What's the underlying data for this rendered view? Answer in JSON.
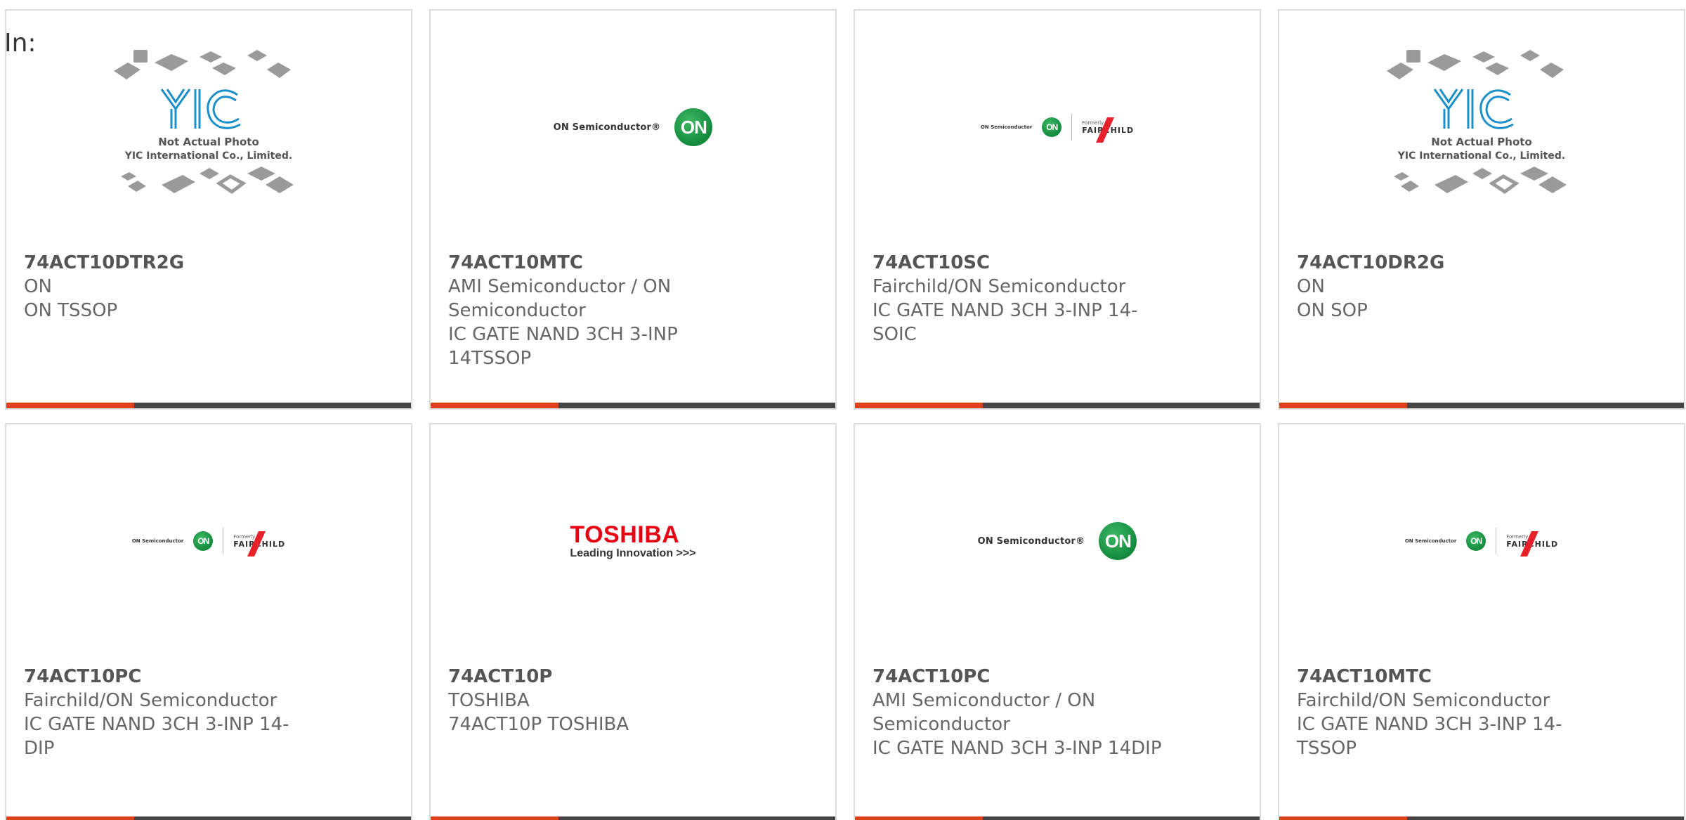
{
  "page": {
    "in_label": "In:"
  },
  "products": [
    {
      "part_no": "74ACT10DTR2G",
      "manufacturer": "ON",
      "description": "ON TSSOP",
      "image": "yic-not-actual-photo",
      "image_caption_1": "Not Actual Photo",
      "image_caption_2": "YIC International Co., Limited."
    },
    {
      "part_no": "74ACT10MTC",
      "manufacturer": "AMI Semiconductor / ON Semiconductor",
      "description": "IC GATE NAND 3CH 3-INP 14TSSOP",
      "image": "on-semiconductor-logo",
      "logo_text": "ON Semiconductor®",
      "logo_mark": "ON"
    },
    {
      "part_no": "74ACT10SC",
      "manufacturer": "Fairchild/ON Semiconductor",
      "description": "IC GATE NAND 3CH 3-INP 14-SOIC",
      "image": "on-fairchild-logo",
      "logo_text": "ON Semiconductor",
      "logo_mark": "ON",
      "formerly": "Formerly",
      "fairchild": "FAIRCHILD"
    },
    {
      "part_no": "74ACT10DR2G",
      "manufacturer": "ON",
      "description": "ON SOP",
      "image": "yic-not-actual-photo",
      "image_caption_1": "Not Actual Photo",
      "image_caption_2": "YIC International Co., Limited."
    },
    {
      "part_no": "74ACT10PC",
      "manufacturer": "Fairchild/ON Semiconductor",
      "description": "IC GATE NAND 3CH 3-INP 14-DIP",
      "image": "on-fairchild-logo",
      "logo_text": "ON Semiconductor",
      "logo_mark": "ON",
      "formerly": "Formerly",
      "fairchild": "FAIRCHILD"
    },
    {
      "part_no": "74ACT10P",
      "manufacturer": "TOSHIBA",
      "description": "74ACT10P TOSHIBA",
      "image": "toshiba-logo",
      "logo_name": "TOSHIBA",
      "logo_tagline": "Leading Innovation >>>"
    },
    {
      "part_no": "74ACT10PC",
      "manufacturer": "AMI Semiconductor / ON Semiconductor",
      "description": "IC GATE NAND 3CH 3-INP 14DIP",
      "image": "on-semiconductor-logo",
      "logo_text": "ON Semiconductor®",
      "logo_mark": "ON"
    },
    {
      "part_no": "74ACT10MTC",
      "manufacturer": "Fairchild/ON Semiconductor",
      "description": "IC GATE NAND 3CH 3-INP 14-TSSOP",
      "image": "on-fairchild-logo",
      "logo_text": "ON Semiconductor",
      "logo_mark": "ON",
      "formerly": "Formerly",
      "fairchild": "FAIRCHILD"
    }
  ],
  "colors": {
    "accent": "#e0401a",
    "bar": "#444444",
    "on_green": "#138a3e",
    "toshiba_red": "#e60012",
    "yic_blue": "#1a8fc9"
  }
}
